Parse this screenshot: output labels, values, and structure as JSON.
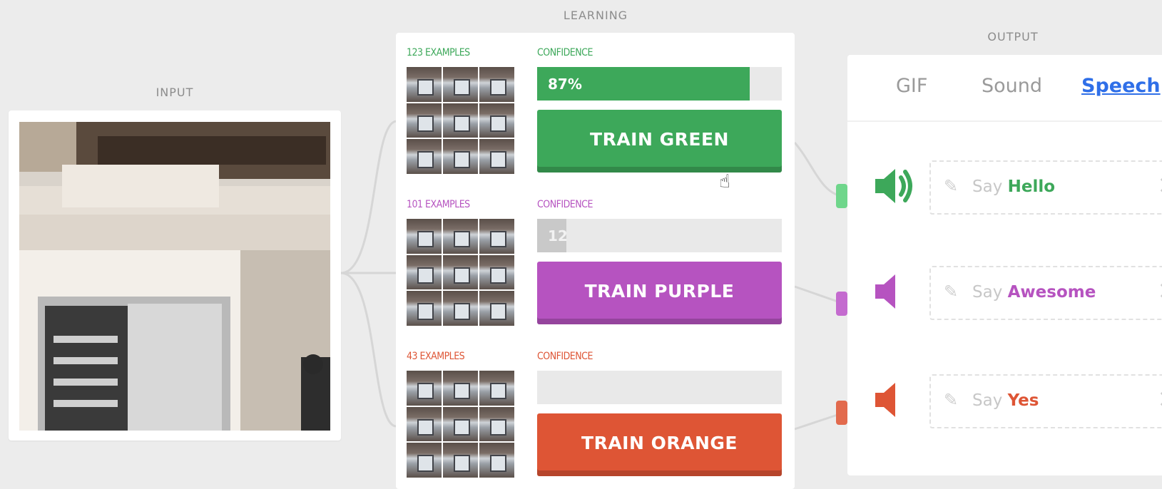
{
  "labels": {
    "input": "INPUT",
    "learning": "LEARNING",
    "output": "OUTPUT"
  },
  "classes": [
    {
      "id": "green",
      "examples": "123 EXAMPLES",
      "confidence_label": "CONFIDENCE",
      "confidence": 0.87,
      "confidence_text": "87%",
      "button": "TRAIN GREEN",
      "color": "#3da85a",
      "fill_color": "#3da85a"
    },
    {
      "id": "purple",
      "examples": "101 EXAMPLES",
      "confidence_label": "CONFIDENCE",
      "confidence": 0.12,
      "confidence_text": "12",
      "button": "TRAIN PURPLE",
      "color": "#b653c0",
      "fill_color": "#c9c9c9"
    },
    {
      "id": "orange",
      "examples": "43 EXAMPLES",
      "confidence_label": "CONFIDENCE",
      "confidence": 0.0,
      "confidence_text": "",
      "button": "TRAIN ORANGE",
      "color": "#de5535",
      "fill_color": "#de5535"
    }
  ],
  "output": {
    "tabs": [
      {
        "label": "GIF",
        "active": false
      },
      {
        "label": "Sound",
        "active": false
      },
      {
        "label": "Speech",
        "active": true
      }
    ],
    "rows": [
      {
        "prefix": "Say",
        "word": "Hello",
        "color": "#3da85a",
        "speaker_icon": "speaker-on-icon"
      },
      {
        "prefix": "Say",
        "word": "Awesome",
        "color": "#b653c0",
        "speaker_icon": "speaker-icon"
      },
      {
        "prefix": "Say",
        "word": "Yes",
        "color": "#de5535",
        "speaker_icon": "speaker-icon"
      }
    ]
  }
}
